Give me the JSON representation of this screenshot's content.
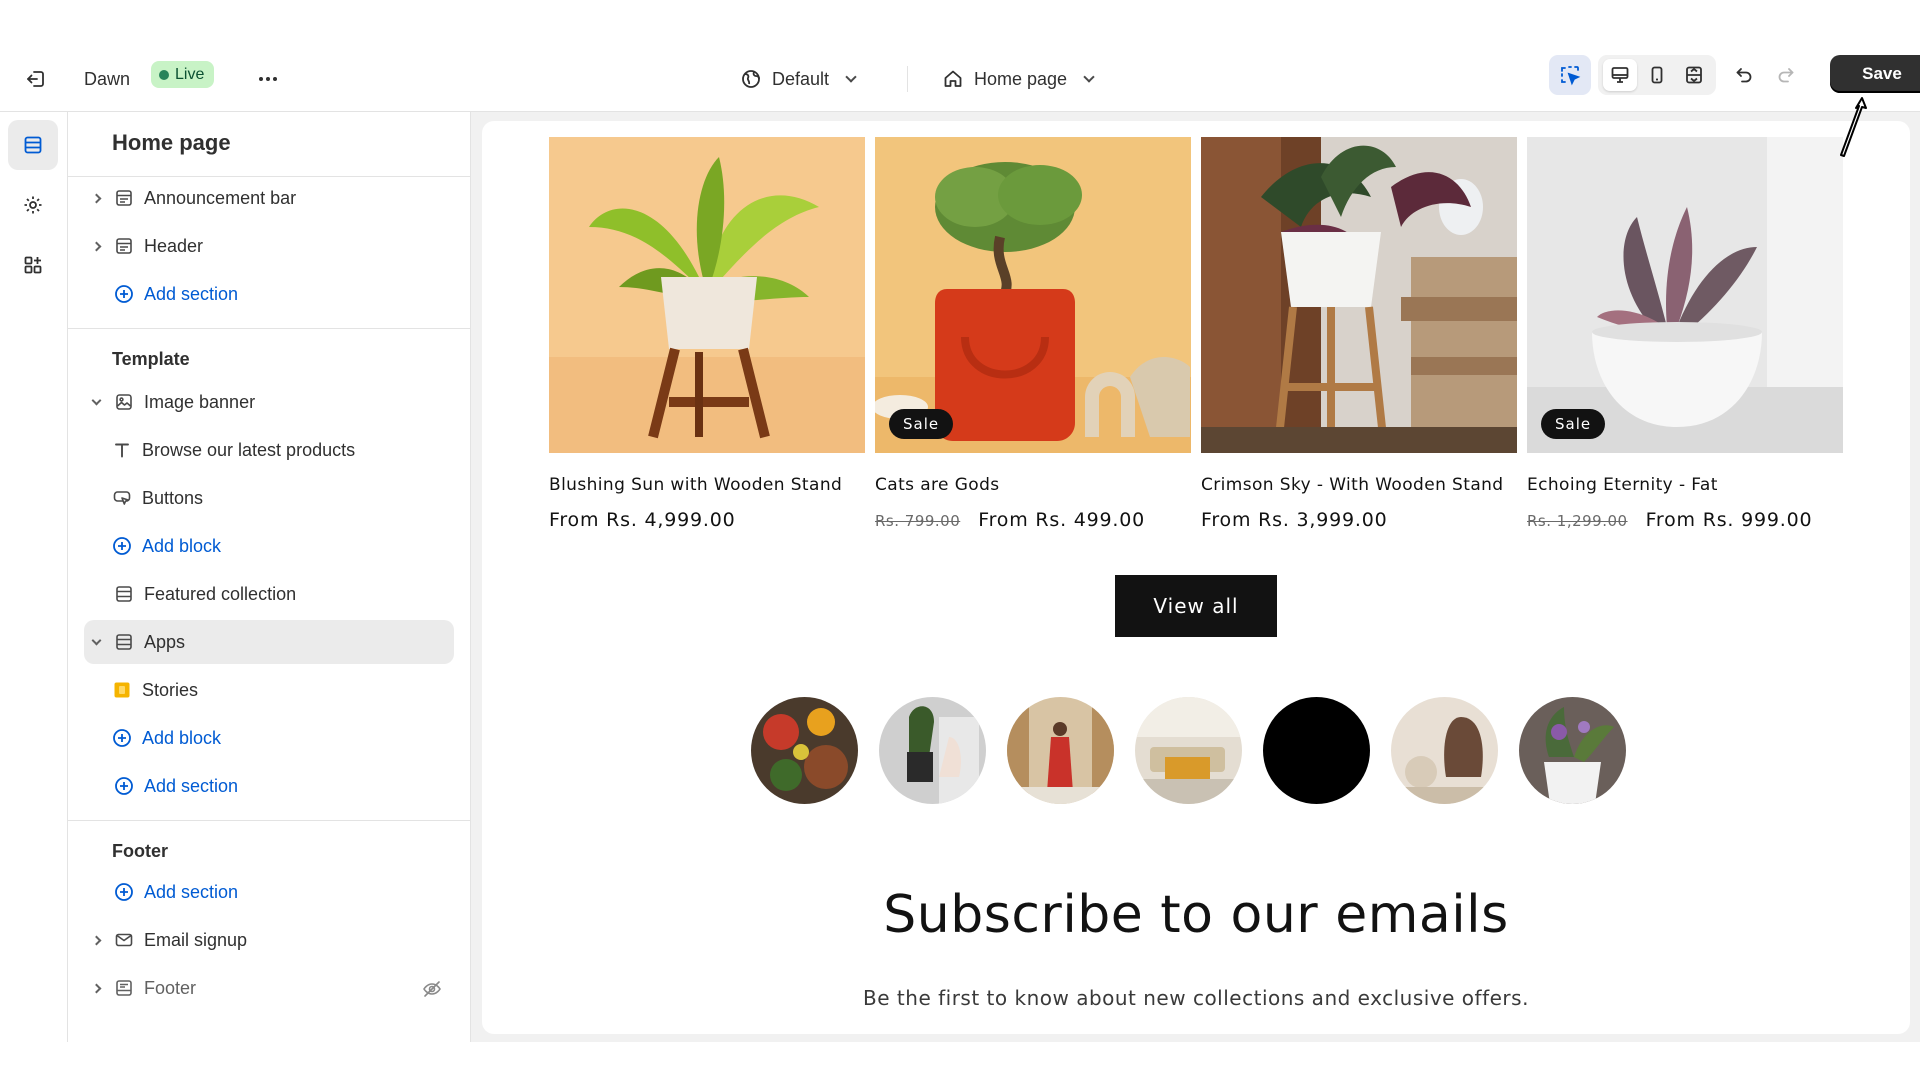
{
  "topbar": {
    "theme_name": "Dawn",
    "live_label": "Live",
    "theme_selector": "Default",
    "page_selector": "Home page",
    "save_label": "Save"
  },
  "sidebar": {
    "title": "Home page",
    "header_group": [
      {
        "label": "Announcement bar",
        "icon": "section-icon"
      },
      {
        "label": "Header",
        "icon": "section-icon"
      },
      {
        "label": "Add section",
        "icon": "plus-circle-icon"
      }
    ],
    "template_heading": "Template",
    "template_items": [
      {
        "label": "Image banner",
        "icon": "image-icon"
      },
      {
        "label": "Browse our latest products",
        "icon": "text-icon"
      },
      {
        "label": "Buttons",
        "icon": "button-icon"
      },
      {
        "label": "Add block",
        "icon": "plus-circle-icon"
      },
      {
        "label": "Featured collection",
        "icon": "section-icon"
      },
      {
        "label": "Apps",
        "icon": "section-icon"
      },
      {
        "label": "Stories",
        "icon": "app-icon"
      },
      {
        "label": "Add block",
        "icon": "plus-circle-icon"
      },
      {
        "label": "Add section",
        "icon": "plus-circle-icon"
      }
    ],
    "footer_heading": "Footer",
    "footer_items": [
      {
        "label": "Add section",
        "icon": "plus-circle-icon"
      },
      {
        "label": "Email signup",
        "icon": "mail-icon"
      },
      {
        "label": "Footer",
        "icon": "footer-icon"
      }
    ]
  },
  "preview": {
    "products": [
      {
        "name": "Blushing Sun with Wooden Stand",
        "price": "From Rs. 4,999.00",
        "old_price": "",
        "sale": ""
      },
      {
        "name": "Cats are Gods",
        "price": "From Rs. 499.00",
        "old_price": "Rs. 799.00",
        "sale": "Sale"
      },
      {
        "name": "Crimson Sky - With Wooden Stand",
        "price": "From Rs. 3,999.00",
        "old_price": "",
        "sale": ""
      },
      {
        "name": "Echoing Eternity - Fat",
        "price": "From Rs. 999.00",
        "old_price": "Rs. 1,299.00",
        "sale": "Sale"
      }
    ],
    "view_all_label": "View all",
    "subscribe_title": "Subscribe to our emails",
    "subscribe_text": "Be the first to know about new collections and exclusive offers."
  },
  "colors": {
    "accent_blue": "#005bd3",
    "live_green": "#29845a",
    "dark_button": "#121212"
  }
}
